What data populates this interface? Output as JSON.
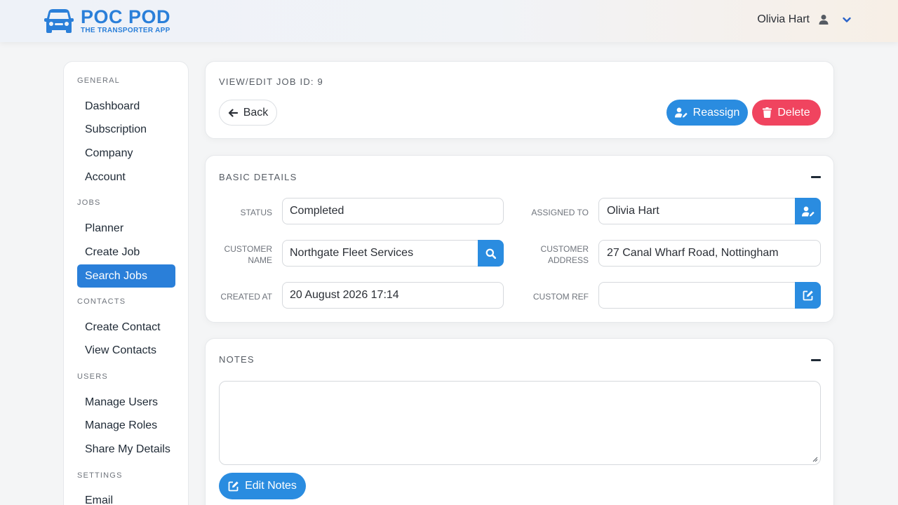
{
  "app": {
    "title": "POC POD",
    "subtitle": "THE TRANSPORTER APP",
    "brand_color": "#2a7fd9"
  },
  "header": {
    "user_name": "Olivia Hart",
    "user_icon": "person-icon",
    "menu_icon": "chevron-down-icon"
  },
  "sidebar": {
    "sections": [
      {
        "title": "GENERAL",
        "items": [
          "Dashboard",
          "Subscription",
          "Company",
          "Account"
        ]
      },
      {
        "title": "JOBS",
        "items": [
          "Planner",
          "Create Job",
          "Search Jobs"
        ]
      },
      {
        "title": "CONTACTS",
        "items": [
          "Create Contact",
          "View Contacts"
        ]
      },
      {
        "title": "USERS",
        "items": [
          "Manage Users",
          "Manage Roles",
          "Share My Details"
        ]
      },
      {
        "title": "SETTINGS",
        "items": [
          "Email"
        ]
      }
    ],
    "active_item": "Search Jobs",
    "active_color": "#2a7fd9"
  },
  "job_header": {
    "title": "VIEW/EDIT JOB ID: 9",
    "back_label": "Back",
    "reassign_label": "Reassign",
    "delete_label": "Delete",
    "reassign_color": "#2a8ce0",
    "delete_color": "#f0445f"
  },
  "basic_details": {
    "title": "BASIC DETAILS",
    "status_label": "STATUS",
    "status_value": "Completed",
    "assigned_label": "ASSIGNED TO",
    "assigned_value": "Olivia Hart",
    "customer_name_label_1": "CUSTOMER",
    "customer_name_label_2": "NAME",
    "customer_name_value": "Northgate Fleet Services",
    "customer_address_label_1": "CUSTOMER",
    "customer_address_label_2": "ADDRESS",
    "customer_address_value": "27 Canal Wharf Road, Nottingham",
    "created_label": "CREATED AT",
    "created_value": "20 August 2026 17:14",
    "custom_ref_label": "CUSTOM REF",
    "custom_ref_value": ""
  },
  "notes": {
    "title": "NOTES",
    "value": "",
    "edit_label": "Edit Notes"
  }
}
